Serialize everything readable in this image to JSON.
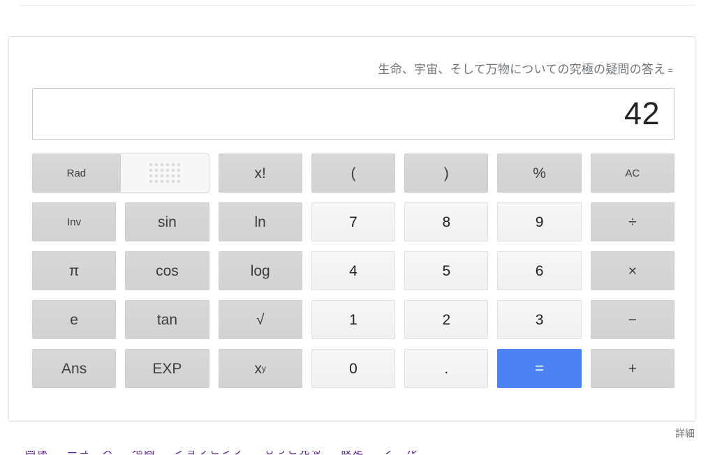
{
  "page": {
    "language": "ja",
    "background_color": "#ffffff"
  },
  "colors": {
    "accent_blue": "#4d82f3",
    "function_key_bg": "#d4d4d4",
    "number_key_bg": "#f4f4f4",
    "label_text": "#70757a",
    "display_text": "#202124",
    "card_border": "#e4e4e4",
    "link_visited": "#551a8b"
  },
  "calculator": {
    "expression_label": "生命、宇宙、そして万物についての究極の疑問の答え",
    "equals_sign": "=",
    "display_value": "42",
    "display_placeholder": "",
    "angle_mode": {
      "active_label": "Rad",
      "inactive_icon": "keypad-grid-icon",
      "active_index": 0
    },
    "rows": [
      [
        {
          "label": "x!",
          "name": "factorial",
          "style": "fn"
        },
        {
          "label": "(",
          "name": "open-paren",
          "style": "fn"
        },
        {
          "label": ")",
          "name": "close-paren",
          "style": "fn"
        },
        {
          "label": "%",
          "name": "percent",
          "style": "fn"
        },
        {
          "label": "AC",
          "name": "all-clear",
          "style": "fn",
          "small": true
        }
      ],
      [
        {
          "label": "Inv",
          "name": "inverse",
          "style": "fn",
          "small": true
        },
        {
          "label": "sin",
          "name": "sin",
          "style": "fn"
        },
        {
          "label": "ln",
          "name": "natural-log",
          "style": "fn"
        },
        {
          "label": "7",
          "name": "digit-7",
          "style": "num"
        },
        {
          "label": "8",
          "name": "digit-8",
          "style": "num"
        },
        {
          "label": "9",
          "name": "digit-9",
          "style": "num"
        },
        {
          "label": "÷",
          "name": "divide",
          "style": "fn"
        }
      ],
      [
        {
          "label": "π",
          "name": "pi",
          "style": "fn"
        },
        {
          "label": "cos",
          "name": "cos",
          "style": "fn"
        },
        {
          "label": "log",
          "name": "log",
          "style": "fn"
        },
        {
          "label": "4",
          "name": "digit-4",
          "style": "num"
        },
        {
          "label": "5",
          "name": "digit-5",
          "style": "num"
        },
        {
          "label": "6",
          "name": "digit-6",
          "style": "num"
        },
        {
          "label": "×",
          "name": "multiply",
          "style": "fn"
        }
      ],
      [
        {
          "label": "e",
          "name": "euler-number",
          "style": "fn"
        },
        {
          "label": "tan",
          "name": "tan",
          "style": "fn"
        },
        {
          "label": "√",
          "name": "square-root",
          "style": "fn"
        },
        {
          "label": "1",
          "name": "digit-1",
          "style": "num"
        },
        {
          "label": "2",
          "name": "digit-2",
          "style": "num"
        },
        {
          "label": "3",
          "name": "digit-3",
          "style": "num"
        },
        {
          "label": "−",
          "name": "subtract",
          "style": "fn"
        }
      ],
      [
        {
          "label": "Ans",
          "name": "answer",
          "style": "fn"
        },
        {
          "label": "EXP",
          "name": "exponent",
          "style": "fn"
        },
        {
          "label": "x",
          "superscript": "y",
          "name": "power",
          "style": "fn"
        },
        {
          "label": "0",
          "name": "digit-0",
          "style": "num"
        },
        {
          "label": ".",
          "name": "decimal-point",
          "style": "num"
        },
        {
          "label": "=",
          "name": "equals",
          "style": "equals"
        },
        {
          "label": "+",
          "name": "add",
          "style": "fn"
        }
      ]
    ]
  },
  "footer": {
    "details_label": "詳細",
    "clipped_links": [
      "画像",
      "ニュース",
      "地図",
      "ショッピング",
      "もっと見る",
      "設定",
      "ツール"
    ]
  }
}
